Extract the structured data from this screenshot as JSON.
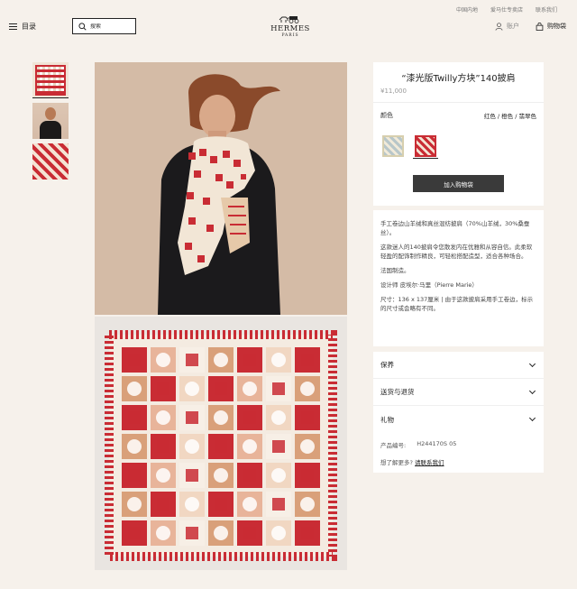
{
  "top_links": [
    "中国内地",
    "爱马仕专卖店",
    "联系我们"
  ],
  "header": {
    "menu_label": "目录",
    "search_placeholder": "搜索",
    "logo_name": "HERMES",
    "logo_city": "PARIS",
    "account_label": "账户",
    "bag_label": "购物袋"
  },
  "product": {
    "title": "“漆光版Twilly方块”140披肩",
    "price": "¥11,000",
    "color_label": "颜色",
    "color_value": "红色 / 橙色 / 翡翠色",
    "add_to_bag": "加入购物袋"
  },
  "description": {
    "material": "手工卷边山羊绒和真丝混纺披肩（70%山羊绒，30%桑蚕丝）。",
    "story": "这款迷人的140披肩令您散发内在优雅和从容自信。此柔软轻盈的配饰制作精良，可轻松搭配造型，适合各种场合。",
    "origin": "法国制造。",
    "designer": "设计师 皮埃尔·马里（Pierre Marie）",
    "size": "尺寸：136 x 137厘米 | 由于这款披肩采用手工卷边，标示的尺寸或会略有不同。"
  },
  "accordion": [
    "保养",
    "送货与退货",
    "礼物"
  ],
  "meta": {
    "code_label": "产品编号:",
    "code_value": "H244170S 05",
    "help_text": "想了解更多?",
    "help_link": "请联系我们"
  },
  "icons": {
    "menu": "hamburger-icon",
    "search": "search-icon",
    "account": "user-icon",
    "bag": "bag-icon",
    "accordion": "chevron-down-icon"
  },
  "colors": {
    "background": "#f6f1eb",
    "button": "#3a3a3a",
    "scarf_red": "#c92c34"
  }
}
